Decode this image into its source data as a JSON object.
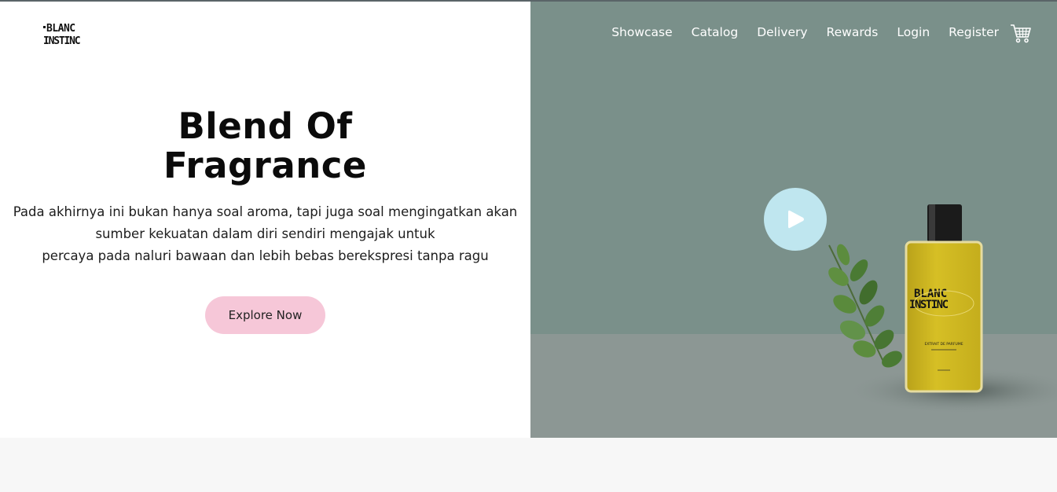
{
  "brand": {
    "logo_top": "BLANC",
    "logo_bottom": "INSTINC",
    "bottle_label_sub": "EXTRAIT DE PARFUME"
  },
  "nav": {
    "items": [
      {
        "label": "Showcase"
      },
      {
        "label": "Catalog"
      },
      {
        "label": "Delivery"
      },
      {
        "label": "Rewards"
      },
      {
        "label": "Login"
      },
      {
        "label": "Register"
      }
    ],
    "cart_icon": "shopping-cart-icon"
  },
  "hero": {
    "title_line1": "Blend Of",
    "title_line2": "Fragrance",
    "desc_line1": "Pada akhirnya ini bukan hanya soal aroma, tapi juga soal mengingatkan akan",
    "desc_line2": "sumber kekuatan dalam diri sendiri mengajak untuk",
    "desc_line3": "percaya pada naluri bawaan dan lebih bebas berekspresi tanpa ragu",
    "cta_label": "Explore Now",
    "play_icon": "play-icon"
  },
  "colors": {
    "panel": "#7a908a",
    "floor": "#8c9794",
    "cta": "#f6c7d8",
    "play": "#bfe6ef",
    "bottle": "#d1b920"
  }
}
